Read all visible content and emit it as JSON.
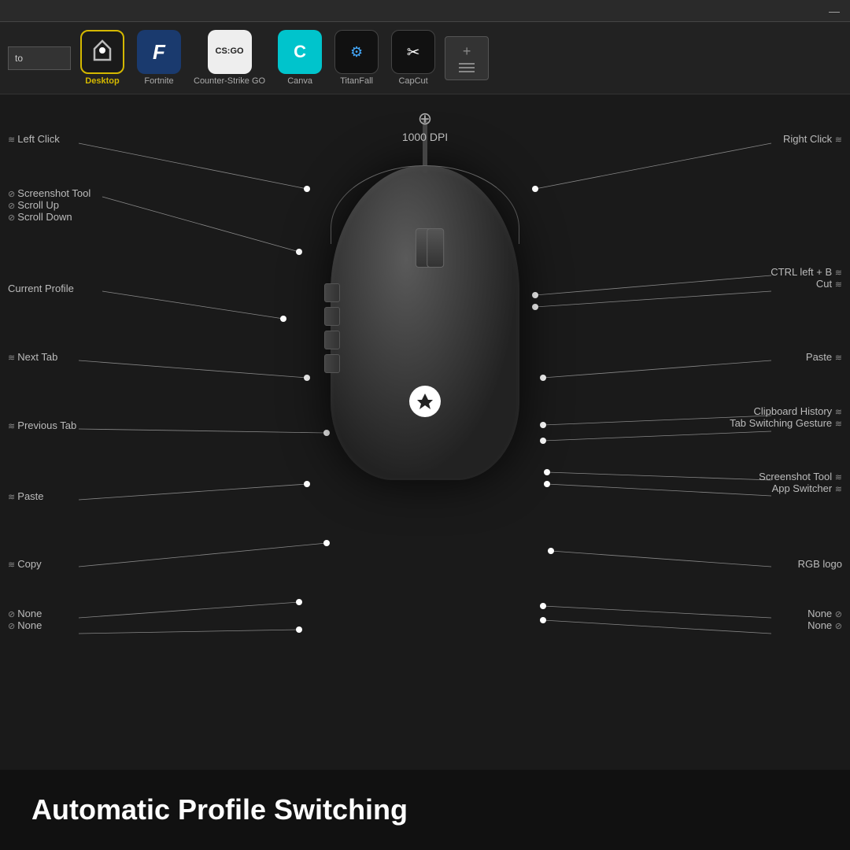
{
  "titlebar": {
    "minimize_label": "—"
  },
  "profile_bar": {
    "search_placeholder": "to",
    "profiles": [
      {
        "id": "desktop",
        "label": "Desktop",
        "active": true,
        "icon": "🖱",
        "bg": "desktop"
      },
      {
        "id": "fortnite",
        "label": "Fortnite",
        "active": false,
        "icon": "F",
        "bg": "fortnite"
      },
      {
        "id": "csgo",
        "label": "Counter-Strike GO",
        "active": false,
        "icon": "⊛",
        "bg": "csgo"
      },
      {
        "id": "canva",
        "label": "Canva",
        "active": false,
        "icon": "C",
        "bg": "canva"
      },
      {
        "id": "titanfall",
        "label": "TitanFall",
        "active": false,
        "icon": "⚙",
        "bg": "titanfall"
      },
      {
        "id": "capcut",
        "label": "CapCut",
        "active": false,
        "icon": "✂",
        "bg": "capcut"
      }
    ],
    "add_label": "+"
  },
  "dpi": {
    "value": "1000 DPI"
  },
  "labels": {
    "left_click": "Left Click",
    "right_click": "Right Click",
    "screenshot_tool": "Screenshot Tool",
    "scroll_up": "Scroll Up",
    "scroll_down": "Scroll Down",
    "current_profile": "Current Profile",
    "ctrl_left_b": "CTRL left + B",
    "cut": "Cut",
    "next_tab": "Next Tab",
    "paste_right": "Paste",
    "previous_tab": "Previous Tab",
    "clipboard_history": "Clipboard History",
    "tab_switching_gesture": "Tab Switching Gesture",
    "paste_left": "Paste",
    "screenshot_tool_right": "Screenshot Tool",
    "app_switcher": "App Switcher",
    "copy": "Copy",
    "rgb_logo": "RGB logo",
    "none1": "None",
    "none2": "None",
    "none3": "None",
    "none4": "None"
  },
  "bottom": {
    "title": "Automatic Profile Switching"
  }
}
